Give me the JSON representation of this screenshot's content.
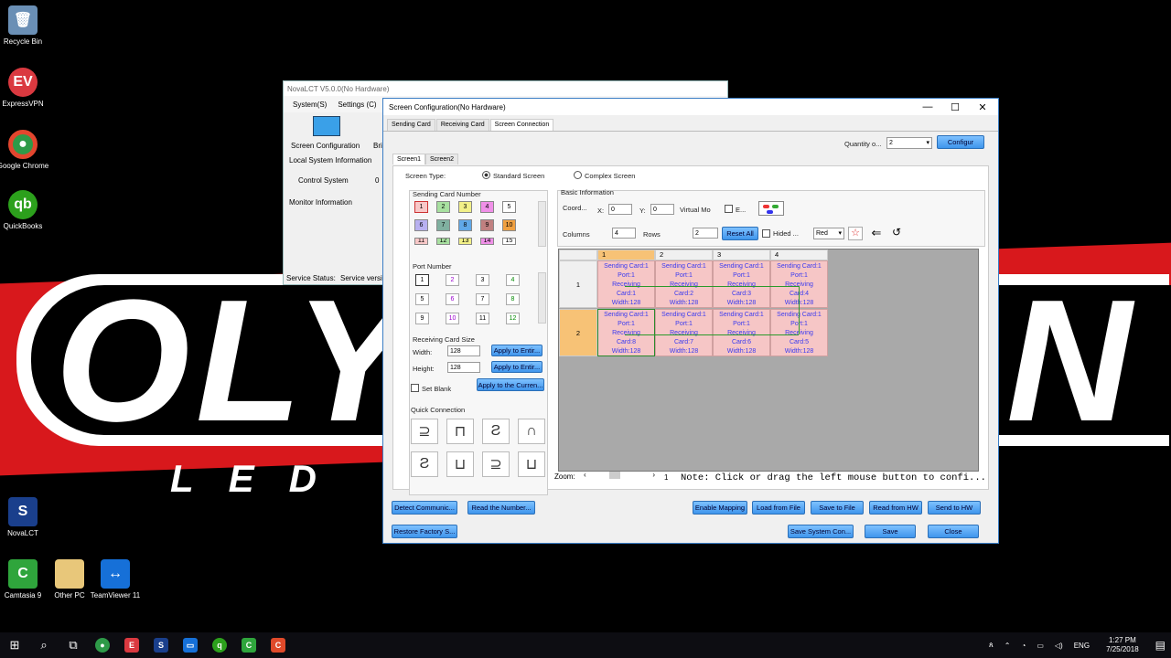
{
  "desktop": {
    "icons": [
      {
        "label": "Recycle Bin",
        "icon": "recycle-bin-icon",
        "color": "#6a8fb5"
      },
      {
        "label": "ExpressVPN",
        "icon": "expressvpn-icon",
        "color": "#da3940"
      },
      {
        "label": "Google Chrome",
        "icon": "chrome-icon",
        "color": "#2e9a48"
      },
      {
        "label": "QuickBooks",
        "icon": "quickbooks-icon",
        "color": "#2ca01c"
      },
      {
        "label": "NovaLCT",
        "icon": "novalct-icon",
        "color": "#1a3f8c"
      },
      {
        "label": "Camtasia 9",
        "icon": "camtasia-icon",
        "color": "#2fa53c"
      },
      {
        "label": "Other PC",
        "icon": "folder-icon",
        "color": "#e8c77a"
      },
      {
        "label": "TeamViewer 11",
        "icon": "teamviewer-icon",
        "color": "#1670d8"
      }
    ],
    "logo_text": "OLY",
    "logo_text_right": "N",
    "led_text": "LED"
  },
  "nova_window": {
    "title": "NovaLCT V5.0.0(No Hardware)",
    "menu": [
      "System(S)",
      "Settings (C)"
    ],
    "screen_config_label": "Screen Configuration",
    "br_label": "Bri",
    "local_info": "Local System Information",
    "control_system": "Control System",
    "control_value": "0",
    "monitor_info": "Monitor Information",
    "service_status": "Service Status:",
    "service_version": "Service versi"
  },
  "dialog": {
    "title": "Screen Configuration(No Hardware)",
    "tabs": [
      "Sending Card",
      "Receiving Card",
      "Screen Connection"
    ],
    "quantity_label": "Quantity o...",
    "quantity_value": "2",
    "configure_btn": "Configur",
    "screen_tabs": [
      "Screen1",
      "Screen2"
    ],
    "screen_type_label": "Screen Type:",
    "standard_screen": "Standard Screen",
    "complex_screen": "Complex Screen",
    "sending_card_number": "Sending Card Number",
    "sending_cards": [
      {
        "n": "1",
        "c": "#f8c8c8"
      },
      {
        "n": "2",
        "c": "#a8e0a0"
      },
      {
        "n": "3",
        "c": "#f2f088"
      },
      {
        "n": "4",
        "c": "#f090e8"
      },
      {
        "n": "5",
        "c": "#ffffff"
      },
      {
        "n": "6",
        "c": "#b8b0f0"
      },
      {
        "n": "7",
        "c": "#80b0a0"
      },
      {
        "n": "8",
        "c": "#60a8e8"
      },
      {
        "n": "9",
        "c": "#c08080"
      },
      {
        "n": "10",
        "c": "#f0a040"
      },
      {
        "n": "11",
        "c": "#f8c8c8"
      },
      {
        "n": "12",
        "c": "#a8e0a0"
      },
      {
        "n": "13",
        "c": "#f2f088"
      },
      {
        "n": "14",
        "c": "#f090e8"
      },
      {
        "n": "15",
        "c": "#ffffff"
      }
    ],
    "port_number": "Port Number",
    "ports": [
      "1",
      "2",
      "3",
      "4",
      "5",
      "6",
      "7",
      "8",
      "9",
      "10",
      "11",
      "12"
    ],
    "receiving_card_size": "Receiving Card Size",
    "width_label": "Width:",
    "width_value": "128",
    "height_label": "Height:",
    "height_value": "128",
    "apply_entire": "Apply to Entir...",
    "apply_entire2": "Apply to Entir...",
    "set_blank": "Set Blank",
    "apply_current": "Apply to the Curren...",
    "quick_connection": "Quick Connection",
    "quick_glyphs": [
      "⊇",
      "⊓",
      "Ƨ",
      "∩",
      "Ƨ",
      "⊔",
      "⊇",
      "⊔"
    ],
    "basic_info": "Basic Information",
    "coord_label": "Coord...",
    "x_label": "X:",
    "x_value": "0",
    "y_label": "Y:",
    "y_value": "0",
    "virtual_mode": "Virtual Mo",
    "e_label": "E...",
    "columns_label": "Columns",
    "columns_value": "4",
    "rows_label": "Rows",
    "rows_value": "2",
    "reset_all": "Reset All",
    "hided_label": "Hided ...",
    "color_value": "Red",
    "col_headers": [
      "1",
      "2",
      "3",
      "4"
    ],
    "row_headers": [
      "1",
      "2"
    ],
    "cells": [
      [
        "Sending Card:1",
        "Port:1",
        "Receiving",
        "Card:1",
        "Width:128"
      ],
      [
        "Sending Card:1",
        "Port:1",
        "Receiving",
        "Card:2",
        "Width:128"
      ],
      [
        "Sending Card:1",
        "Port:1",
        "Receiving",
        "Card:3",
        "Width:128"
      ],
      [
        "Sending Card:1",
        "Port:1",
        "Receiving",
        "Card:4",
        "Width:128"
      ],
      [
        "Sending Card:1",
        "Port:1",
        "Receiving",
        "Card:8",
        "Width:128"
      ],
      [
        "Sending Card:1",
        "Port:1",
        "Receiving",
        "Card:7",
        "Width:128"
      ],
      [
        "Sending Card:1",
        "Port:1",
        "Receiving",
        "Card:6",
        "Width:128"
      ],
      [
        "Sending Card:1",
        "Port:1",
        "Receiving",
        "Card:5",
        "Width:128"
      ]
    ],
    "zoom_label": "Zoom:",
    "zoom_value": "1",
    "note": "Note: Click or drag the left mouse button to confi...",
    "bottom_buttons": {
      "detect": "Detect Communic...",
      "read_number": "Read the Number...",
      "enable_mapping": "Enable Mapping",
      "load_file": "Load from File",
      "save_file": "Save to File",
      "read_hw": "Read from HW",
      "send_hw": "Send to HW",
      "restore": "Restore Factory S...",
      "save_system": "Save System Con...",
      "save": "Save",
      "close": "Close"
    }
  },
  "taskbar": {
    "time": "1:27 PM",
    "date": "7/25/2018",
    "lang": "ENG"
  }
}
